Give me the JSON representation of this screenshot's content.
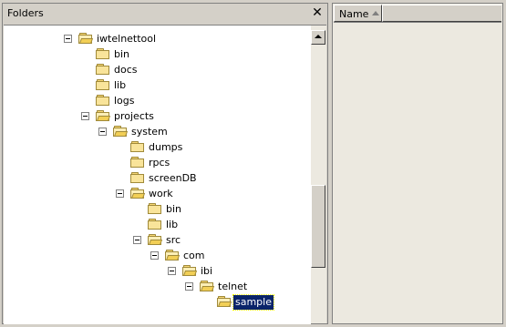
{
  "folders_pane": {
    "title": "Folders",
    "close_label": "✕"
  },
  "tree": [
    {
      "label": "iwtelnettool",
      "expanded": true
    },
    {
      "label": "bin"
    },
    {
      "label": "docs"
    },
    {
      "label": "lib"
    },
    {
      "label": "logs"
    },
    {
      "label": "projects",
      "expanded": true
    },
    {
      "label": "system",
      "expanded": true
    },
    {
      "label": "dumps"
    },
    {
      "label": "rpcs"
    },
    {
      "label": "screenDB"
    },
    {
      "label": "work",
      "expanded": true
    },
    {
      "label": "bin"
    },
    {
      "label": "lib"
    },
    {
      "label": "src",
      "expanded": true
    },
    {
      "label": "com",
      "expanded": true
    },
    {
      "label": "ibi",
      "expanded": true
    },
    {
      "label": "telnet",
      "expanded": true
    },
    {
      "label": "sample",
      "selected": true
    }
  ],
  "right_pane": {
    "column_name": "Name",
    "sort": "ascending"
  }
}
